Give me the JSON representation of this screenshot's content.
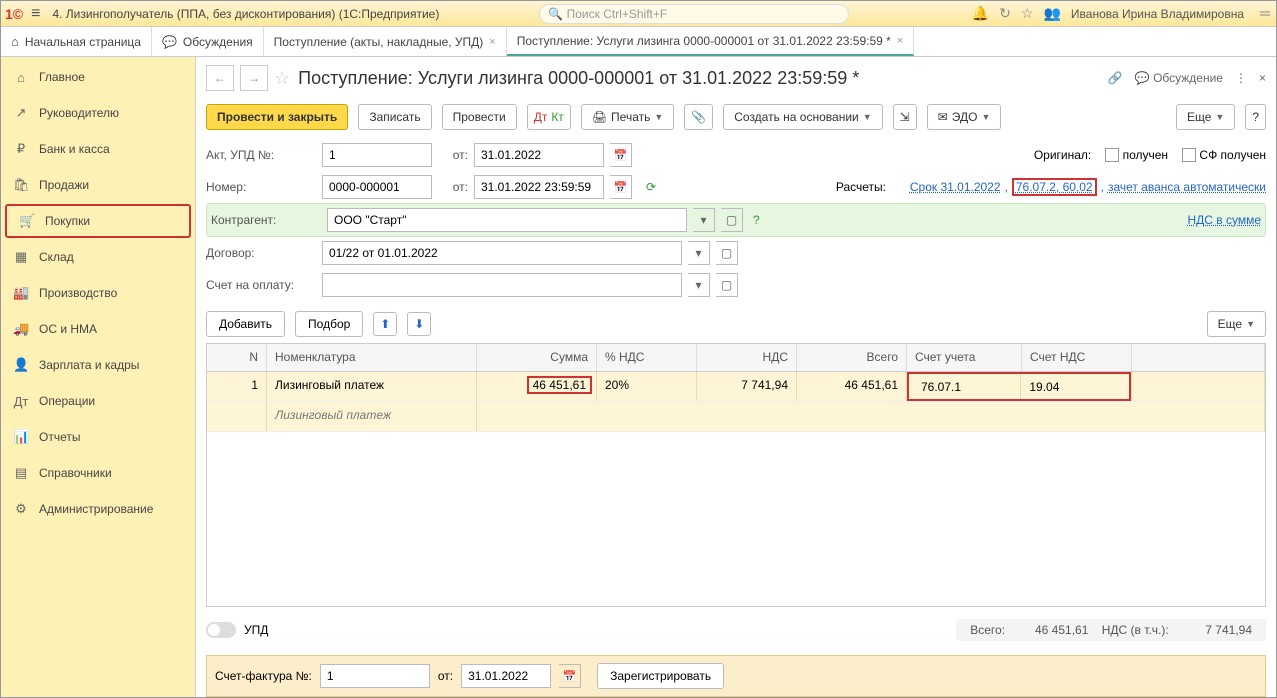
{
  "titlebar": {
    "title": "4. Лизингополучатель (ППА, без дисконтирования)  (1С:Предприятие)",
    "search_placeholder": "Поиск Ctrl+Shift+F",
    "user": "Иванова Ирина Владимировна"
  },
  "tabs": [
    {
      "label": "Начальная страница"
    },
    {
      "label": "Обсуждения"
    },
    {
      "label": "Поступление (акты, накладные, УПД)"
    },
    {
      "label": "Поступление: Услуги лизинга 0000-000001 от 31.01.2022 23:59:59 *",
      "active": true
    }
  ],
  "sidebar": [
    {
      "icon": "⌂",
      "label": "Главное"
    },
    {
      "icon": "↗",
      "label": "Руководителю"
    },
    {
      "icon": "₽",
      "label": "Банк и касса"
    },
    {
      "icon": "🛍",
      "label": "Продажи"
    },
    {
      "icon": "🛒",
      "label": "Покупки",
      "selected": true
    },
    {
      "icon": "▦",
      "label": "Склад"
    },
    {
      "icon": "🏭",
      "label": "Производство"
    },
    {
      "icon": "🚚",
      "label": "ОС и НМА"
    },
    {
      "icon": "👤",
      "label": "Зарплата и кадры"
    },
    {
      "icon": "Дт",
      "label": "Операции"
    },
    {
      "icon": "📊",
      "label": "Отчеты"
    },
    {
      "icon": "▤",
      "label": "Справочники"
    },
    {
      "icon": "⚙",
      "label": "Администрирование"
    }
  ],
  "page": {
    "title": "Поступление: Услуги лизинга 0000-000001 от 31.01.2022 23:59:59 *",
    "discussion": "Обсуждение"
  },
  "toolbar": {
    "post_close": "Провести и закрыть",
    "save": "Записать",
    "post": "Провести",
    "print": "Печать",
    "create_based": "Создать на основании",
    "edo": "ЭДО",
    "more": "Еще"
  },
  "form": {
    "act_label": "Акт, УПД №:",
    "act_no": "1",
    "act_from": "от:",
    "act_date": "31.01.2022",
    "num_label": "Номер:",
    "num": "0000-000001",
    "num_from": "от:",
    "num_date": "31.01.2022 23:59:59",
    "original_label": "Оригинал:",
    "received": "получен",
    "sf_received": "СФ получен",
    "calc_label": "Расчеты:",
    "calc_link1": "Срок 31.01.2022",
    "calc_link_hl": "76.07.2, 60.02",
    "calc_link3": "зачет аванса автоматически",
    "counterparty_label": "Контрагент:",
    "counterparty": "ООО \"Старт\"",
    "vat_link": "НДС в сумме",
    "contract_label": "Договор:",
    "contract": "01/22 от 01.01.2022",
    "pay_account_label": "Счет на оплату:"
  },
  "tbl_toolbar": {
    "add": "Добавить",
    "pick": "Подбор",
    "more": "Еще"
  },
  "grid": {
    "headers": {
      "n": "N",
      "nom": "Номенклатура",
      "sum": "Сумма",
      "vat": "% НДС",
      "vatamt": "НДС",
      "tot": "Всего",
      "acc": "Счет учета",
      "vatacc": "Счет НДС"
    },
    "row": {
      "n": "1",
      "nom": "Лизинговый платеж",
      "nom_sub": "Лизинговый платеж",
      "sum": "46 451,61",
      "vat": "20%",
      "vatamt": "7 741,94",
      "tot": "46 451,61",
      "acc": "76.07.1",
      "vatacc": "19.04"
    }
  },
  "totals": {
    "upd": "УПД",
    "total_label": "Всего:",
    "total": "46 451,61",
    "vat_label": "НДС (в т.ч.):",
    "vat": "7 741,94"
  },
  "sf": {
    "label": "Счет-фактура №:",
    "no": "1",
    "from": "от:",
    "date": "31.01.2022",
    "register": "Зарегистрировать"
  }
}
